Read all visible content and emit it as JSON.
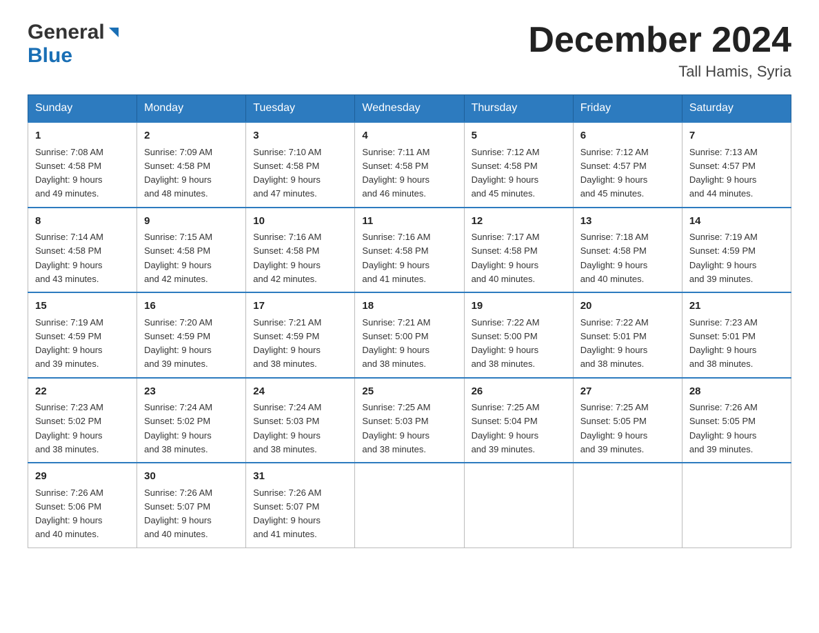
{
  "header": {
    "logo_general": "General",
    "logo_blue": "Blue",
    "month_title": "December 2024",
    "location": "Tall Hamis, Syria"
  },
  "calendar": {
    "days_of_week": [
      "Sunday",
      "Monday",
      "Tuesday",
      "Wednesday",
      "Thursday",
      "Friday",
      "Saturday"
    ],
    "weeks": [
      [
        {
          "day": "1",
          "sunrise": "7:08 AM",
          "sunset": "4:58 PM",
          "daylight": "9 hours and 49 minutes."
        },
        {
          "day": "2",
          "sunrise": "7:09 AM",
          "sunset": "4:58 PM",
          "daylight": "9 hours and 48 minutes."
        },
        {
          "day": "3",
          "sunrise": "7:10 AM",
          "sunset": "4:58 PM",
          "daylight": "9 hours and 47 minutes."
        },
        {
          "day": "4",
          "sunrise": "7:11 AM",
          "sunset": "4:58 PM",
          "daylight": "9 hours and 46 minutes."
        },
        {
          "day": "5",
          "sunrise": "7:12 AM",
          "sunset": "4:58 PM",
          "daylight": "9 hours and 45 minutes."
        },
        {
          "day": "6",
          "sunrise": "7:12 AM",
          "sunset": "4:57 PM",
          "daylight": "9 hours and 45 minutes."
        },
        {
          "day": "7",
          "sunrise": "7:13 AM",
          "sunset": "4:57 PM",
          "daylight": "9 hours and 44 minutes."
        }
      ],
      [
        {
          "day": "8",
          "sunrise": "7:14 AM",
          "sunset": "4:58 PM",
          "daylight": "9 hours and 43 minutes."
        },
        {
          "day": "9",
          "sunrise": "7:15 AM",
          "sunset": "4:58 PM",
          "daylight": "9 hours and 42 minutes."
        },
        {
          "day": "10",
          "sunrise": "7:16 AM",
          "sunset": "4:58 PM",
          "daylight": "9 hours and 42 minutes."
        },
        {
          "day": "11",
          "sunrise": "7:16 AM",
          "sunset": "4:58 PM",
          "daylight": "9 hours and 41 minutes."
        },
        {
          "day": "12",
          "sunrise": "7:17 AM",
          "sunset": "4:58 PM",
          "daylight": "9 hours and 40 minutes."
        },
        {
          "day": "13",
          "sunrise": "7:18 AM",
          "sunset": "4:58 PM",
          "daylight": "9 hours and 40 minutes."
        },
        {
          "day": "14",
          "sunrise": "7:19 AM",
          "sunset": "4:59 PM",
          "daylight": "9 hours and 39 minutes."
        }
      ],
      [
        {
          "day": "15",
          "sunrise": "7:19 AM",
          "sunset": "4:59 PM",
          "daylight": "9 hours and 39 minutes."
        },
        {
          "day": "16",
          "sunrise": "7:20 AM",
          "sunset": "4:59 PM",
          "daylight": "9 hours and 39 minutes."
        },
        {
          "day": "17",
          "sunrise": "7:21 AM",
          "sunset": "4:59 PM",
          "daylight": "9 hours and 38 minutes."
        },
        {
          "day": "18",
          "sunrise": "7:21 AM",
          "sunset": "5:00 PM",
          "daylight": "9 hours and 38 minutes."
        },
        {
          "day": "19",
          "sunrise": "7:22 AM",
          "sunset": "5:00 PM",
          "daylight": "9 hours and 38 minutes."
        },
        {
          "day": "20",
          "sunrise": "7:22 AM",
          "sunset": "5:01 PM",
          "daylight": "9 hours and 38 minutes."
        },
        {
          "day": "21",
          "sunrise": "7:23 AM",
          "sunset": "5:01 PM",
          "daylight": "9 hours and 38 minutes."
        }
      ],
      [
        {
          "day": "22",
          "sunrise": "7:23 AM",
          "sunset": "5:02 PM",
          "daylight": "9 hours and 38 minutes."
        },
        {
          "day": "23",
          "sunrise": "7:24 AM",
          "sunset": "5:02 PM",
          "daylight": "9 hours and 38 minutes."
        },
        {
          "day": "24",
          "sunrise": "7:24 AM",
          "sunset": "5:03 PM",
          "daylight": "9 hours and 38 minutes."
        },
        {
          "day": "25",
          "sunrise": "7:25 AM",
          "sunset": "5:03 PM",
          "daylight": "9 hours and 38 minutes."
        },
        {
          "day": "26",
          "sunrise": "7:25 AM",
          "sunset": "5:04 PM",
          "daylight": "9 hours and 39 minutes."
        },
        {
          "day": "27",
          "sunrise": "7:25 AM",
          "sunset": "5:05 PM",
          "daylight": "9 hours and 39 minutes."
        },
        {
          "day": "28",
          "sunrise": "7:26 AM",
          "sunset": "5:05 PM",
          "daylight": "9 hours and 39 minutes."
        }
      ],
      [
        {
          "day": "29",
          "sunrise": "7:26 AM",
          "sunset": "5:06 PM",
          "daylight": "9 hours and 40 minutes."
        },
        {
          "day": "30",
          "sunrise": "7:26 AM",
          "sunset": "5:07 PM",
          "daylight": "9 hours and 40 minutes."
        },
        {
          "day": "31",
          "sunrise": "7:26 AM",
          "sunset": "5:07 PM",
          "daylight": "9 hours and 41 minutes."
        },
        null,
        null,
        null,
        null
      ]
    ],
    "labels": {
      "sunrise": "Sunrise:",
      "sunset": "Sunset:",
      "daylight": "Daylight:"
    }
  }
}
